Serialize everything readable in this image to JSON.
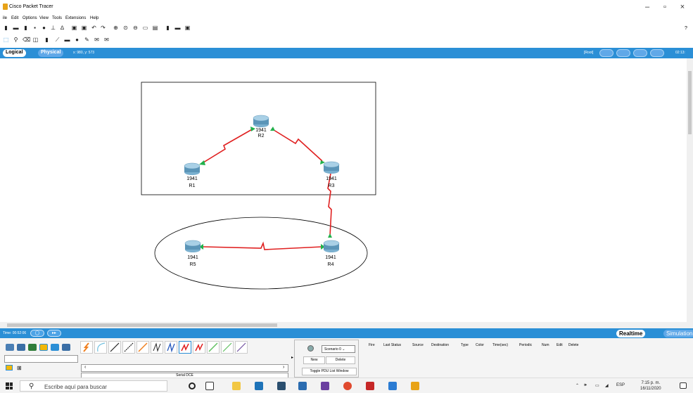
{
  "window": {
    "title": "Cisco Packet Tracer",
    "minimize": "–",
    "maximize": "▫",
    "close": "×"
  },
  "menu": {
    "items": [
      "ile",
      "Edit",
      "Options",
      "View",
      "Tools",
      "Extensions",
      "Help"
    ],
    "help_mark": "?"
  },
  "logical_bar": {
    "logical_tab": "Logical",
    "physical_tab": "Physical",
    "coords": "x: 980, y: 573",
    "root_label": "[Root]",
    "clock": "02:13:"
  },
  "workspace": {
    "devices": [
      {
        "model": "1941",
        "name": "R1"
      },
      {
        "model": "1941",
        "name": "R2"
      },
      {
        "model": "1941",
        "name": "R3"
      },
      {
        "model": "1941",
        "name": "R4"
      },
      {
        "model": "1941",
        "name": "R5"
      }
    ]
  },
  "time_bar": {
    "time": "Time: 00:52:06",
    "realtime": "Realtime",
    "simulation": "Simulation"
  },
  "bottom_panel": {
    "connection_type_label": "Serial DCE",
    "scenario": "Scenario 0",
    "new_button": "New",
    "delete_button": "Delete",
    "toggle_button": "Toggle PDU List Window",
    "pdu_columns": [
      "Fire",
      "Last Status",
      "Source",
      "Destination",
      "Type",
      "Color",
      "Time(sec)",
      "Periodic",
      "Num",
      "Edit",
      "Delete"
    ]
  },
  "taskbar": {
    "search_placeholder": "Escribe aquí para buscar",
    "language": "ESP",
    "time": "7:15 p. m.",
    "date": "16/11/2020"
  },
  "colors": {
    "accent_blue": "#2b8fd6",
    "link_red": "#e02020",
    "link_green": "#22b14c",
    "router_blue": "#5b95b8"
  }
}
